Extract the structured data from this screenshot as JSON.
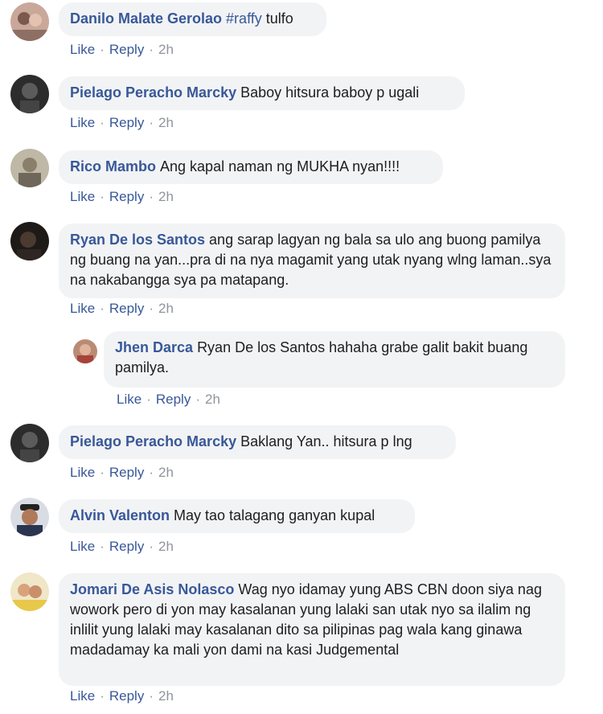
{
  "comments": [
    {
      "author": "Danilo Malate Gerolao",
      "hashtag": "#raffy",
      "text": " tulfo",
      "like": "Like",
      "reply": "Reply",
      "time": "2h"
    },
    {
      "author": "Pielago Peracho Marcky",
      "text": "Baboy hitsura baboy p ugali",
      "like": "Like",
      "reply": "Reply",
      "time": "2h"
    },
    {
      "author": "Rico Mambo",
      "text": "Ang kapal naman ng MUKHA nyan!!!!",
      "like": "Like",
      "reply": "Reply",
      "time": "2h"
    },
    {
      "author": "Ryan De los Santos",
      "text": "ang sarap lagyan ng bala sa ulo ang buong pamilya ng buang na yan...pra di na nya magamit yang utak nyang wlng laman..sya na nakabangga sya pa matapang.",
      "like": "Like",
      "reply": "Reply",
      "time": "2h"
    },
    {
      "author": "Jhen Darca",
      "text": "Ryan De los Santos hahaha grabe galit bakit buang pamilya.",
      "like": "Like",
      "reply": "Reply",
      "time": "2h"
    },
    {
      "author": "Pielago Peracho Marcky",
      "text": "Baklang Yan.. hitsura p lng",
      "like": "Like",
      "reply": "Reply",
      "time": "2h"
    },
    {
      "author": "Alvin Valenton",
      "text": "May tao talagang ganyan kupal",
      "like": "Like",
      "reply": "Reply",
      "time": "2h"
    },
    {
      "author": "Jomari De Asis Nolasco",
      "text": "Wag nyo idamay yung ABS CBN doon siya nag wowork pero di yon may kasalanan yung lalaki san utak nyo sa ilalim ng inlilit yung lalaki may kasalanan dito sa pilipinas pag wala kang ginawa madadamay ka mali yon dami na kasi Judgemental",
      "like": "Like",
      "reply": "Reply",
      "time": "2h"
    }
  ],
  "colors": {
    "link": "#385898",
    "muted": "#90949c",
    "bubble": "#f2f3f5"
  }
}
